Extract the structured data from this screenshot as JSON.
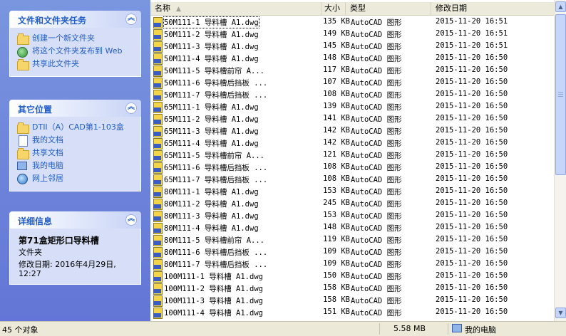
{
  "taskpane": {
    "file_tasks": {
      "title": "文件和文件夹任务",
      "items": [
        {
          "label": "创建一个新文件夹",
          "icon": "new-folder-icon"
        },
        {
          "label": "将这个文件夹发布到 Web",
          "icon": "publish-web-icon"
        },
        {
          "label": "共享此文件夹",
          "icon": "share-folder-icon"
        }
      ]
    },
    "other_places": {
      "title": "其它位置",
      "items": [
        {
          "label": "DTII（A）CAD第1-103盒",
          "icon": "folder-icon"
        },
        {
          "label": "我的文档",
          "icon": "my-documents-icon"
        },
        {
          "label": "共享文档",
          "icon": "shared-documents-icon"
        },
        {
          "label": "我的电脑",
          "icon": "my-computer-icon"
        },
        {
          "label": "网上邻居",
          "icon": "network-places-icon"
        }
      ]
    },
    "details": {
      "title": "详细信息",
      "name": "第71盒矩形口导料槽",
      "kind": "文件夹",
      "modified": "修改日期: 2016年4月29日, 12:27"
    }
  },
  "columns": {
    "name": "名称",
    "size": "大小",
    "type": "类型",
    "date": "修改日期"
  },
  "files": [
    {
      "name": "50M111-1  导料槽  A1.dwg",
      "size": "135 KB",
      "type": "AutoCAD 图形",
      "date": "2015-11-20 16:51"
    },
    {
      "name": "50M111-2  导料槽  A1.dwg",
      "size": "149 KB",
      "type": "AutoCAD 图形",
      "date": "2015-11-20 16:51"
    },
    {
      "name": "50M111-3  导料槽  A1.dwg",
      "size": "145 KB",
      "type": "AutoCAD 图形",
      "date": "2015-11-20 16:51"
    },
    {
      "name": "50M111-4  导料槽  A1.dwg",
      "size": "148 KB",
      "type": "AutoCAD 图形",
      "date": "2015-11-20 16:50"
    },
    {
      "name": "50M111-5  导料槽前帘  A...",
      "size": "117 KB",
      "type": "AutoCAD 图形",
      "date": "2015-11-20 16:50"
    },
    {
      "name": "50M111-6  导料槽后挡板 ...",
      "size": "107 KB",
      "type": "AutoCAD 图形",
      "date": "2015-11-20 16:50"
    },
    {
      "name": "50M111-7  导料槽后挡板 ...",
      "size": "108 KB",
      "type": "AutoCAD 图形",
      "date": "2015-11-20 16:50"
    },
    {
      "name": "65M111-1  导料槽  A1.dwg",
      "size": "139 KB",
      "type": "AutoCAD 图形",
      "date": "2015-11-20 16:50"
    },
    {
      "name": "65M111-2  导料槽  A1.dwg",
      "size": "141 KB",
      "type": "AutoCAD 图形",
      "date": "2015-11-20 16:50"
    },
    {
      "name": "65M111-3  导料槽  A1.dwg",
      "size": "142 KB",
      "type": "AutoCAD 图形",
      "date": "2015-11-20 16:50"
    },
    {
      "name": "65M111-4  导料槽  A1.dwg",
      "size": "142 KB",
      "type": "AutoCAD 图形",
      "date": "2015-11-20 16:50"
    },
    {
      "name": "65M111-5  导料槽前帘  A...",
      "size": "121 KB",
      "type": "AutoCAD 图形",
      "date": "2015-11-20 16:50"
    },
    {
      "name": "65M111-6  导料槽后挡板 ...",
      "size": "108 KB",
      "type": "AutoCAD 图形",
      "date": "2015-11-20 16:50"
    },
    {
      "name": "65M111-7  导料槽后挡板 ...",
      "size": "108 KB",
      "type": "AutoCAD 图形",
      "date": "2015-11-20 16:50"
    },
    {
      "name": "80M111-1  导料槽  A1.dwg",
      "size": "153 KB",
      "type": "AutoCAD 图形",
      "date": "2015-11-20 16:50"
    },
    {
      "name": "80M111-2  导料槽  A1.dwg",
      "size": "245 KB",
      "type": "AutoCAD 图形",
      "date": "2015-11-20 16:50"
    },
    {
      "name": "80M111-3  导料槽  A1.dwg",
      "size": "153 KB",
      "type": "AutoCAD 图形",
      "date": "2015-11-20 16:50"
    },
    {
      "name": "80M111-4  导料槽  A1.dwg",
      "size": "148 KB",
      "type": "AutoCAD 图形",
      "date": "2015-11-20 16:50"
    },
    {
      "name": "80M111-5  导料槽前帘  A...",
      "size": "119 KB",
      "type": "AutoCAD 图形",
      "date": "2015-11-20 16:50"
    },
    {
      "name": "80M111-6  导料槽后挡板 ...",
      "size": "109 KB",
      "type": "AutoCAD 图形",
      "date": "2015-11-20 16:50"
    },
    {
      "name": "80M111-7  导料槽后挡板 ...",
      "size": "109 KB",
      "type": "AutoCAD 图形",
      "date": "2015-11-20 16:50"
    },
    {
      "name": "100M111-1  导料槽  A1.dwg",
      "size": "150 KB",
      "type": "AutoCAD 图形",
      "date": "2015-11-20 16:50"
    },
    {
      "name": "100M111-2  导料槽  A1.dwg",
      "size": "158 KB",
      "type": "AutoCAD 图形",
      "date": "2015-11-20 16:50"
    },
    {
      "name": "100M111-3 导料槽 A1.dwg",
      "size": "158 KB",
      "type": "AutoCAD 图形",
      "date": "2015-11-20 16:50"
    },
    {
      "name": "100M111-4 导料槽 A1.dwg",
      "size": "151 KB",
      "type": "AutoCAD 图形",
      "date": "2015-11-20 16:50"
    }
  ],
  "statusbar": {
    "count": "45 个对象",
    "size": "5.58 MB",
    "location": "我的电脑"
  },
  "colors": {
    "pane_bg": "#6375d6",
    "panel_body": "#d6dff7",
    "link": "#215dc6"
  }
}
